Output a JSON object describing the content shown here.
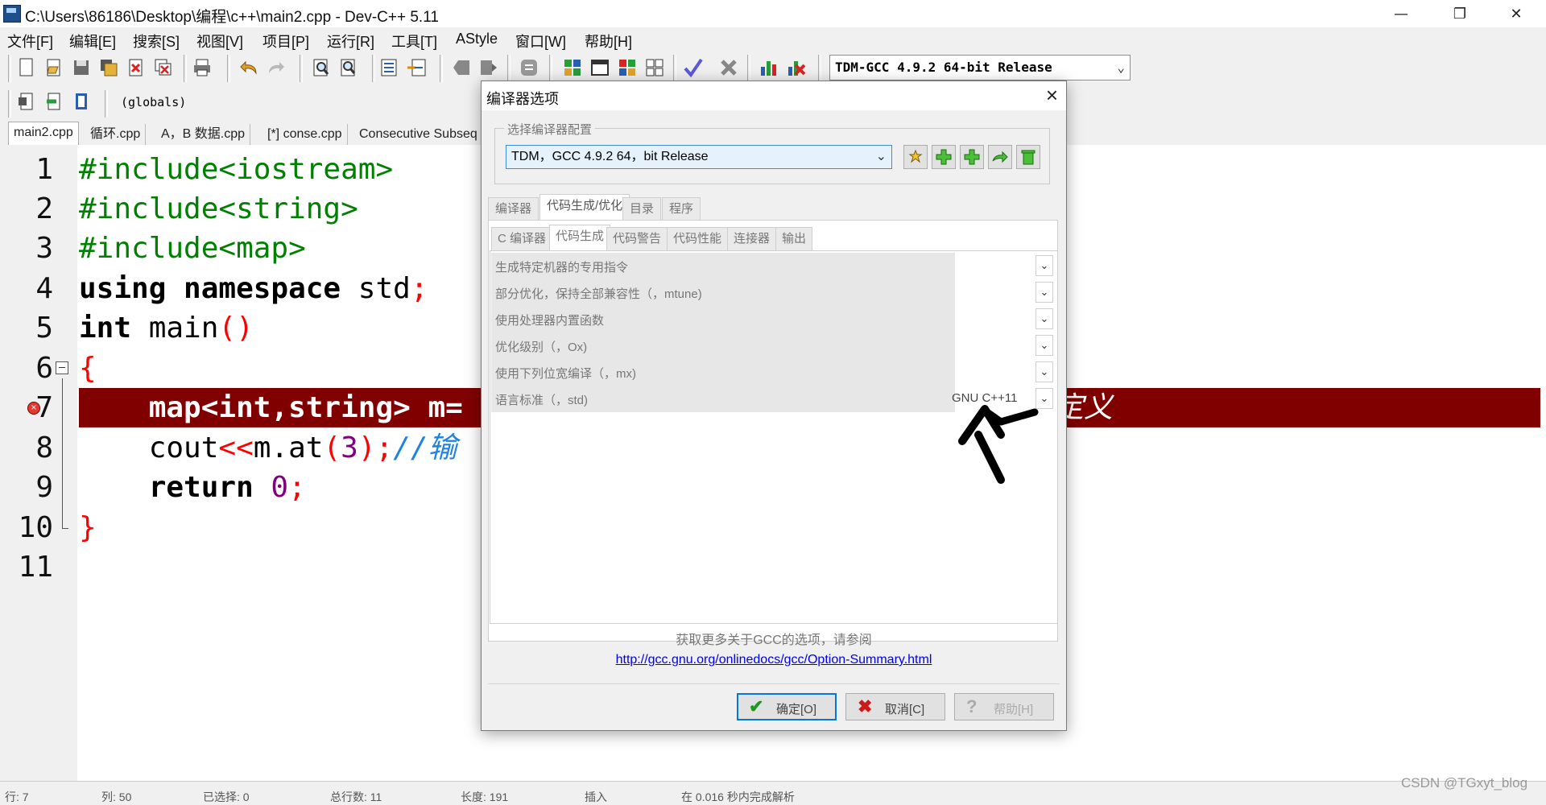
{
  "window": {
    "title": "C:\\Users\\86186\\Desktop\\编程\\c++\\main2.cpp - Dev-C++ 5.11"
  },
  "menu": [
    "文件[F]",
    "编辑[E]",
    "搜索[S]",
    "视图[V]",
    "项目[P]",
    "运行[R]",
    "工具[T]",
    "AStyle",
    "窗口[W]",
    "帮助[H]"
  ],
  "toolbar": {
    "compiler": "TDM-GCC 4.9.2 64-bit Release",
    "scope": "(globals)"
  },
  "file_tabs": [
    "main2.cpp",
    "循环.cpp",
    "A，B 数据.cpp",
    "[*] conse.cpp",
    "Consecutive Subseq"
  ],
  "editor": {
    "line_numbers": [
      "1",
      "2",
      "3",
      "4",
      "5",
      "6",
      "7",
      "8",
      "9",
      "10",
      "11"
    ],
    "lines": {
      "l1": "#include<iostream>",
      "l2": "#include<string>",
      "l3": "#include<map>",
      "l4_kw": "using namespace",
      "l4_id": " std",
      "l4_sym": ";",
      "l5_kw": "int",
      "l5_id": " main",
      "l5_sym": "()",
      "l6": "{",
      "l7": "    map<int,string> m=",
      "l8_a": "    cout",
      "l8_b": "<<",
      "l8_c": "m.at",
      "l8_d": "(",
      "l8_e": "3",
      "l8_f": ");",
      "l8_g": "//输",
      "l9_kw": "    return",
      "l9_num": " 0",
      "l9_sym": ";",
      "l10": "}"
    },
    "error_tail": "定义"
  },
  "status": {
    "s1": "行: 7",
    "s2": "列: 50",
    "s3": "已选择: 0",
    "s4": "总行数: 11",
    "s5": "长度: 191",
    "s6": "插入",
    "s7": "在 0.016 秒内完成解析"
  },
  "watermark": "CSDN @TGxyt_blog",
  "dialog": {
    "title": "编译器选项",
    "group_label": "选择编译器配置",
    "compiler_set": "TDM，GCC 4.9.2 64，bit Release",
    "main_tabs": [
      "编译器",
      "代码生成/优化",
      "目录",
      "程序"
    ],
    "sub_tabs": [
      "C 编译器",
      "代码生成",
      "代码警告",
      "代码性能",
      "连接器",
      "输出"
    ],
    "options": [
      {
        "label": "生成特定机器的专用指令",
        "value": ""
      },
      {
        "label": "部分优化，保持全部兼容性（，mtune)",
        "value": ""
      },
      {
        "label": "使用处理器内置函数",
        "value": ""
      },
      {
        "label": "优化级别（，Ox)",
        "value": ""
      },
      {
        "label": "使用下列位宽编译（，mx)",
        "value": ""
      },
      {
        "label": "语言标准（，std)",
        "value": "GNU C++11"
      }
    ],
    "help_text": "获取更多关于GCC的选项，请参阅",
    "help_link": "http://gcc.gnu.org/onlinedocs/gcc/Option-Summary.html",
    "buttons": {
      "ok": "确定[O]",
      "cancel": "取消[C]",
      "help": "帮助[H]"
    }
  },
  "colors": {
    "error_line": "#800000",
    "preprocessor": "#008000",
    "symbol": "#ff0000",
    "number": "#800080",
    "comment": "#1e82e0"
  }
}
